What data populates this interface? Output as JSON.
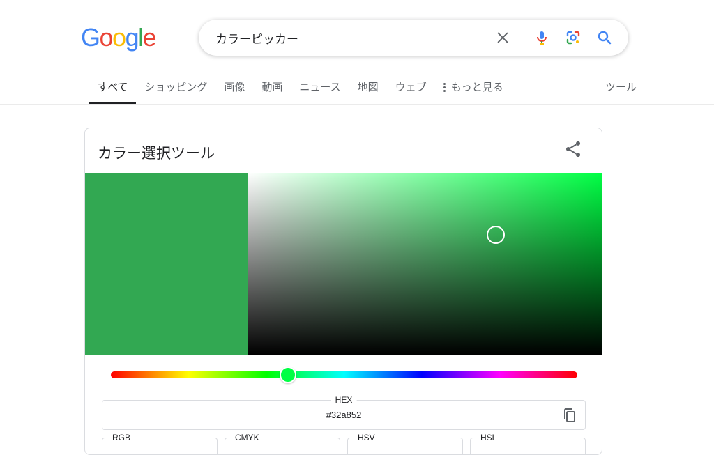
{
  "logo": {
    "letters": [
      {
        "ch": "G",
        "color": "#4285F4"
      },
      {
        "ch": "o",
        "color": "#EA4335"
      },
      {
        "ch": "o",
        "color": "#FBBC05"
      },
      {
        "ch": "g",
        "color": "#4285F4"
      },
      {
        "ch": "l",
        "color": "#34A853"
      },
      {
        "ch": "e",
        "color": "#EA4335"
      }
    ]
  },
  "search": {
    "query": "カラーピッカー",
    "icons": [
      "close-icon",
      "mic-icon",
      "lens-icon",
      "search-icon"
    ]
  },
  "tabs": {
    "items": [
      {
        "label": "すべて",
        "active": true
      },
      {
        "label": "ショッピング"
      },
      {
        "label": "画像"
      },
      {
        "label": "動画"
      },
      {
        "label": "ニュース"
      },
      {
        "label": "地図"
      },
      {
        "label": "ウェブ"
      }
    ],
    "more_label": "もっと見る",
    "tools_label": "ツール"
  },
  "picker": {
    "title": "カラー選択ツール",
    "color": "#32a852",
    "hue_color": "#00ff44",
    "hue_position": 0.38,
    "saturation": 0.7,
    "value": 0.66,
    "hex_label": "HEX",
    "hex_value": "#32a852",
    "formats": [
      "RGB",
      "CMYK",
      "HSV",
      "HSL"
    ]
  }
}
